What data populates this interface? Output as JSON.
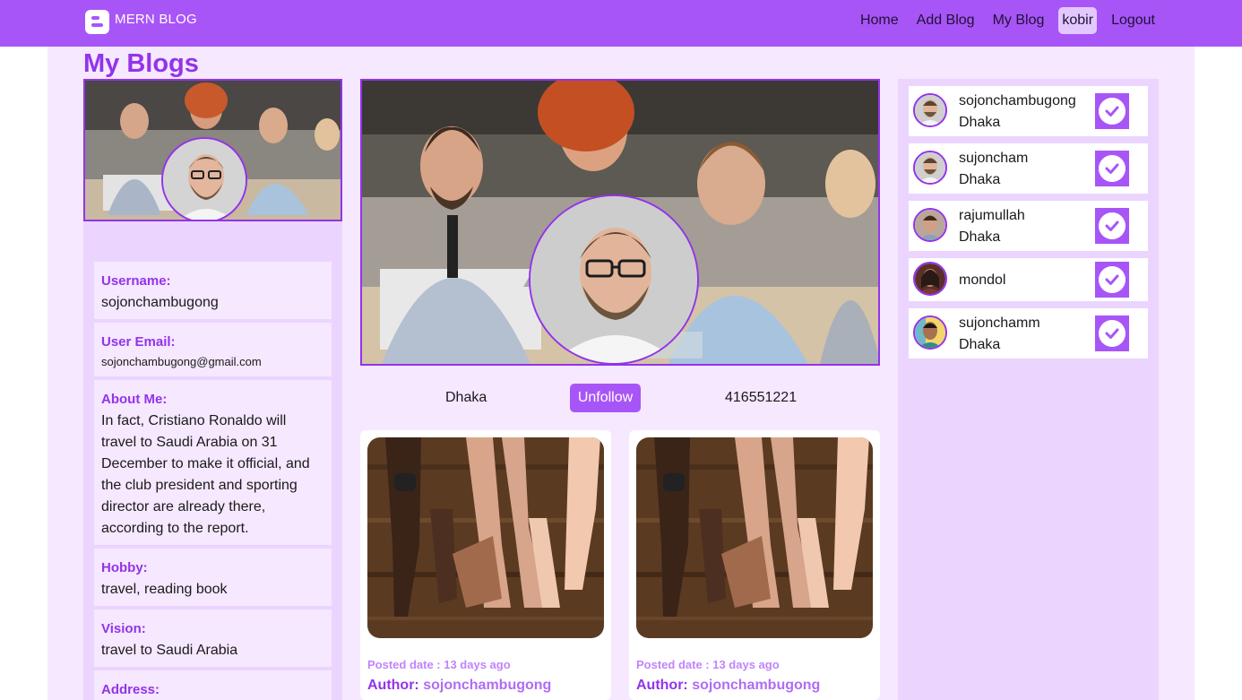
{
  "navbar": {
    "brand": "MERN BLOG",
    "links": [
      "Home",
      "Add Blog",
      "My Blog",
      "kobir",
      "Logout"
    ]
  },
  "page_title": "My Blogs",
  "profile": {
    "username_label": "Username:",
    "username": "sojonchambugong",
    "email_label": "User Email:",
    "email": "sojonchambugong@gmail.com",
    "about_label": "About Me:",
    "about": "In fact, Cristiano Ronaldo will travel to Saudi Arabia on 31 December to make it official, and the club president and sporting director are already there, according to the report.",
    "hobby_label": "Hobby:",
    "hobby": "travel, reading book",
    "vision_label": "Vision:",
    "vision": "travel to Saudi Arabia",
    "address_label": "Address:"
  },
  "meta": {
    "location": "Dhaka",
    "unfollow": "Unfollow",
    "phone": "416551221"
  },
  "posts": [
    {
      "date": "Posted date : 13 days ago",
      "author_label": "Author:",
      "author": "sojonchambugong"
    },
    {
      "date": "Posted date : 13 days ago",
      "author_label": "Author:",
      "author": "sojonchambugong"
    }
  ],
  "users": [
    {
      "name": "sojonchambugong",
      "city": "Dhaka"
    },
    {
      "name": "sujoncham",
      "city": "Dhaka"
    },
    {
      "name": "rajumullah",
      "city": "Dhaka"
    },
    {
      "name": "mondol",
      "city": ""
    },
    {
      "name": "sujonchamm",
      "city": "Dhaka"
    }
  ]
}
